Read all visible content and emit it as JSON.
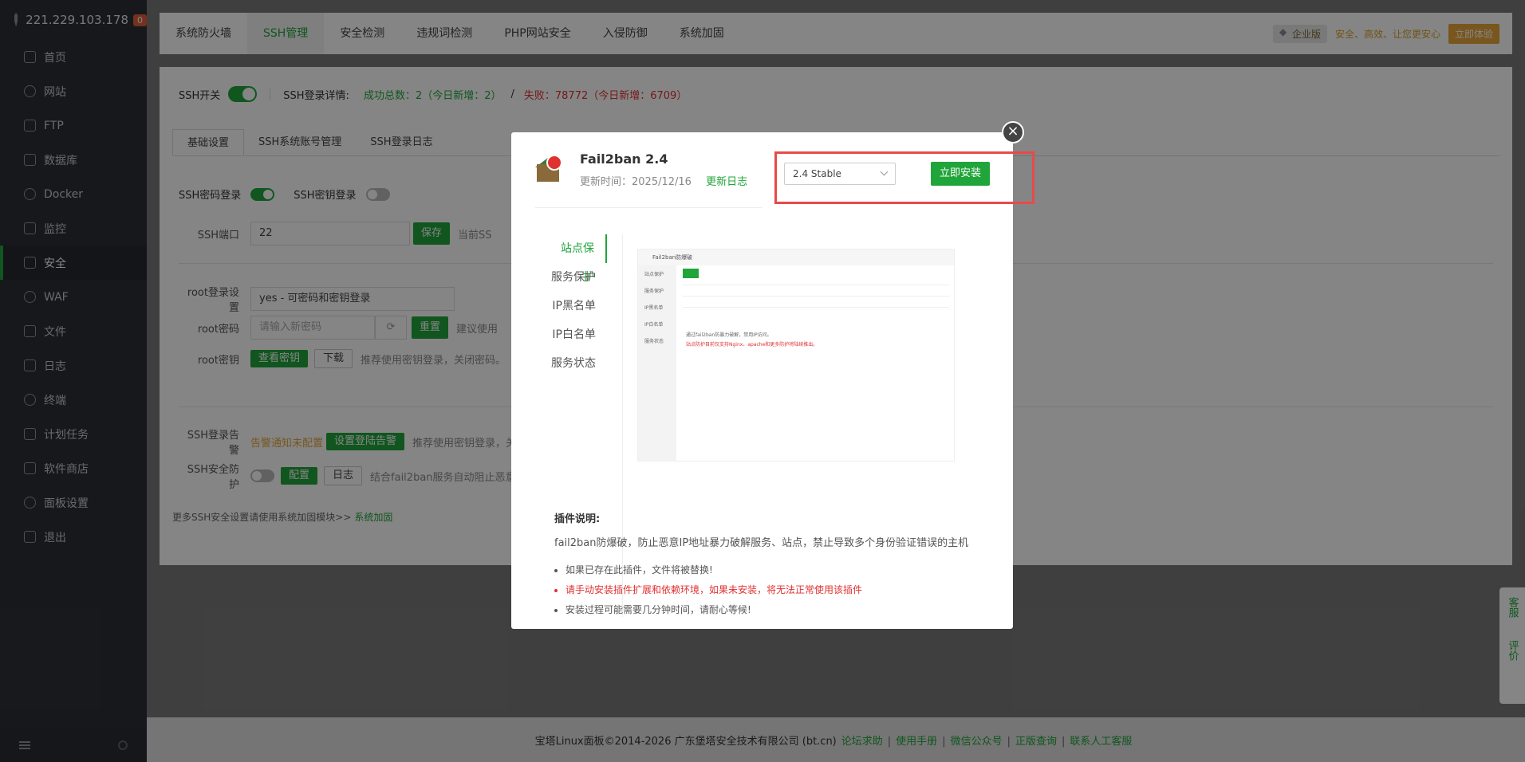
{
  "sidebar": {
    "ip": "221.229.103.178",
    "badge": "0",
    "items": [
      {
        "label": "首页",
        "icon": "home-icon"
      },
      {
        "label": "网站",
        "icon": "globe-icon"
      },
      {
        "label": "FTP",
        "icon": "ftp-icon"
      },
      {
        "label": "数据库",
        "icon": "database-icon"
      },
      {
        "label": "Docker",
        "icon": "docker-icon"
      },
      {
        "label": "监控",
        "icon": "monitor-icon"
      },
      {
        "label": "安全",
        "icon": "shield-icon"
      },
      {
        "label": "WAF",
        "icon": "waf-icon"
      },
      {
        "label": "文件",
        "icon": "folder-icon"
      },
      {
        "label": "日志",
        "icon": "log-icon"
      },
      {
        "label": "终端",
        "icon": "terminal-icon"
      },
      {
        "label": "计划任务",
        "icon": "calendar-icon"
      },
      {
        "label": "软件商店",
        "icon": "grid-icon"
      },
      {
        "label": "面板设置",
        "icon": "settings-icon"
      },
      {
        "label": "退出",
        "icon": "logout-icon"
      }
    ],
    "active_index": 6
  },
  "topbar": {
    "tabs": [
      "系统防火墙",
      "SSH管理",
      "安全检测",
      "违规词检测",
      "PHP网站安全",
      "入侵防御",
      "系统加固"
    ],
    "active_index": 1,
    "enterprise": "企业版",
    "slogan": "安全、高效、让您更安心",
    "try_label": "立即体验"
  },
  "ssh": {
    "switch_label": "SSH开关",
    "login_detail_label": "SSH登录详情:",
    "success": "成功总数：2（今日新增：2）",
    "slash": "/",
    "fail": "失败：78772（今日新增：6709）",
    "subtabs": [
      "基础设置",
      "SSH系统账号管理",
      "SSH登录日志"
    ],
    "password_login": "SSH密码登录",
    "key_login": "SSH密钥登录",
    "port_label": "SSH端口",
    "port_value": "22",
    "save": "保存",
    "port_hint": "当前SS",
    "root_login_label": "root登录设置",
    "root_login_value": "yes - 可密码和密钥登录",
    "root_pwd_label": "root密码",
    "root_pwd_placeholder": "请输入新密码",
    "reset": "重置",
    "reset_hint": "建议使用",
    "root_key_label": "root密钥",
    "view_key": "查看密钥",
    "download": "下载",
    "key_hint": "推荐使用密钥登录，关闭密码。",
    "alert_label": "SSH登录告警",
    "alert_status": "告警通知未配置",
    "alert_btn": "设置登陆告警",
    "alert_hint": "推荐使用密钥登录，关",
    "protect_label": "SSH安全防护",
    "config": "配置",
    "log": "日志",
    "protect_hint": "结合fail2ban服务自动阻止恶意",
    "more": "更多SSH安全设置请使用系统加固模块>>",
    "more_link": "系统加固"
  },
  "footer": {
    "copyright": "宝塔Linux面板©2014-2026 广东堡塔安全技术有限公司 (bt.cn)",
    "links": [
      "论坛求助",
      "使用手册",
      "微信公众号",
      "正版查询",
      "联系人工客服"
    ]
  },
  "float": {
    "service": "客服",
    "rate": "评价"
  },
  "modal": {
    "close": "×",
    "title": "Fail2ban 2.4",
    "update_time": "更新时间：2025/12/16",
    "changelog": "更新日志",
    "version": "2.4 Stable",
    "install": "立即安装",
    "menu": [
      "站点保护",
      "服务保护",
      "IP黑名单",
      "IP白名单",
      "服务状态"
    ],
    "menu_active": 0,
    "preview": {
      "title": "Fail2ban防爆破",
      "left": [
        "站点保护",
        "服务保护",
        "IP黑名单",
        "IP白名单",
        "服务状态"
      ],
      "add": "添加",
      "note1": "通过fail2ban防暴力破解，禁用IP访问。",
      "note2": "站点防护目前仅支持Nginx、apache和更多防护将陆续推出。"
    },
    "desc_title": "插件说明:",
    "desc": "fail2ban防爆破，防止恶意IP地址暴力破解服务、站点，禁止导致多个身份验证错误的主机",
    "bullets": [
      "如果已存在此插件，文件将被替换!",
      "请手动安装插件扩展和依赖环境，如果未安装，将无法正常使用该插件",
      "安装过程可能需要几分钟时间，请耐心等候!"
    ]
  },
  "colors": {
    "accent": "#20a53a",
    "danger": "#e03030",
    "warning": "#e8a53a",
    "sidebar": "#2c2f36"
  }
}
